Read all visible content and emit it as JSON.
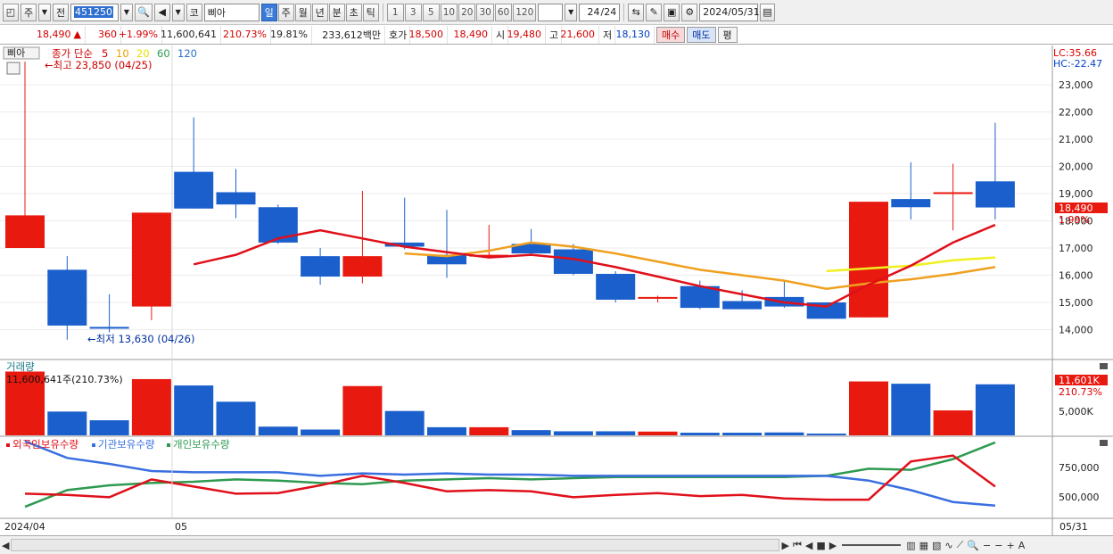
{
  "toolbar": {
    "period_select": "주",
    "prev_label": "전",
    "code": "451250",
    "market_prefix": "코",
    "stock_name": "삐아",
    "interval_tabs": [
      "일",
      "주",
      "월",
      "년",
      "분",
      "초",
      "틱"
    ],
    "active_interval": "일",
    "numbers": [
      "1",
      "3",
      "5",
      "10",
      "20",
      "30",
      "60",
      "120"
    ],
    "page_count": "24",
    "page_total": "/24",
    "date": "2024/05/31"
  },
  "quote": {
    "price": "18,490",
    "arrow": "▲",
    "change": "360",
    "change_pct": "+1.99%",
    "volume": "11,600,641",
    "volume_ratio": "210.73%",
    "turnover": "19.81%",
    "amount": "233,612백만",
    "hoga_label": "호가",
    "ask": "18,500",
    "bid": "18,490",
    "open_label": "시",
    "open": "19,480",
    "high_label": "고",
    "high": "21,600",
    "low_label": "저",
    "low": "18,130",
    "buy_label": "매수",
    "sell_label": "매도",
    "flat_label": "평"
  },
  "price_panel": {
    "stock_tag": "삐아",
    "legend_title": "종가 단순",
    "ma_periods": [
      "5",
      "10",
      "20",
      "60",
      "120"
    ],
    "max_note": "←최고 23,850 (04/25)",
    "min_note": "←최저 13,630 (04/26)",
    "lc_label": "LC:35.66",
    "hc_label": "HC:-22.47",
    "last_price_tag": "18,490",
    "last_pct_tag": "1.99%",
    "y_ticks": [
      "23,000",
      "22,000",
      "21,000",
      "20,000",
      "19,000",
      "18,000",
      "17,000",
      "16,000",
      "15,000",
      "14,000"
    ]
  },
  "volume_panel": {
    "title": "거래량",
    "value_text": "11,600,641주(210.73%)",
    "last_tag": "11,601K",
    "last_pct": "210.73%",
    "y_tick": "5,000K"
  },
  "holding_panel": {
    "legend": [
      "외국인보유수량",
      "기관보유수량",
      "개인보유수량"
    ],
    "y_ticks": [
      "750,000",
      "500,000"
    ]
  },
  "x_axis": {
    "start_label": "2024/04",
    "month_label": "05",
    "end_label": "05/31"
  },
  "colors": {
    "up": "#e8190f",
    "down": "#1a5fcc",
    "ma5": "#e0101a",
    "ma10": "#f0a020",
    "ma20": "#f0f020",
    "foreign": "#e0101a",
    "institution": "#3a6fe0",
    "individual": "#2e9a50"
  },
  "chart_data": {
    "type": "candlestick",
    "candles": [
      {
        "o": 17000,
        "h": 23850,
        "l": 17000,
        "c": 18200
      },
      {
        "o": 16200,
        "h": 16700,
        "l": 13630,
        "c": 14150
      },
      {
        "o": 14100,
        "h": 15300,
        "l": 13900,
        "c": 14050
      },
      {
        "o": 14850,
        "h": 18300,
        "l": 14350,
        "c": 18300
      },
      {
        "o": 19800,
        "h": 21800,
        "l": 18450,
        "c": 18450
      },
      {
        "o": 19050,
        "h": 19900,
        "l": 18100,
        "c": 18600
      },
      {
        "o": 18500,
        "h": 18600,
        "l": 17150,
        "c": 17200
      },
      {
        "o": 16700,
        "h": 17000,
        "l": 15650,
        "c": 15950
      },
      {
        "o": 15950,
        "h": 19100,
        "l": 15700,
        "c": 16700
      },
      {
        "o": 17200,
        "h": 18850,
        "l": 16950,
        "c": 17050
      },
      {
        "o": 16750,
        "h": 18400,
        "l": 15900,
        "c": 16400
      },
      {
        "o": 16700,
        "h": 17850,
        "l": 16650,
        "c": 16750
      },
      {
        "o": 17150,
        "h": 17700,
        "l": 16700,
        "c": 16800
      },
      {
        "o": 16950,
        "h": 17150,
        "l": 16000,
        "c": 16050
      },
      {
        "o": 16050,
        "h": 16150,
        "l": 15000,
        "c": 15100
      },
      {
        "o": 15150,
        "h": 15250,
        "l": 15000,
        "c": 15200
      },
      {
        "o": 15600,
        "h": 15800,
        "l": 14750,
        "c": 14800
      },
      {
        "o": 15050,
        "h": 15450,
        "l": 14750,
        "c": 14750
      },
      {
        "o": 15200,
        "h": 15800,
        "l": 14800,
        "c": 14850
      },
      {
        "o": 15000,
        "h": 15000,
        "l": 14400,
        "c": 14400
      },
      {
        "o": 14450,
        "h": 18700,
        "l": 14450,
        "c": 18700
      },
      {
        "o": 18800,
        "h": 20150,
        "l": 18050,
        "c": 18500
      },
      {
        "o": 19050,
        "h": 20100,
        "l": 17650,
        "c": 19050
      },
      {
        "o": 19450,
        "h": 21600,
        "l": 18050,
        "c": 18490
      }
    ],
    "ma5": [
      null,
      null,
      null,
      null,
      16400,
      16750,
      17350,
      17650,
      17350,
      17050,
      16850,
      16650,
      16750,
      16600,
      16300,
      15950,
      15600,
      15300,
      15000,
      14850,
      15650,
      16350,
      17200,
      17850
    ],
    "ma10": [
      null,
      null,
      null,
      null,
      null,
      null,
      null,
      null,
      null,
      16800,
      16700,
      16900,
      17200,
      17050,
      16800,
      16500,
      16200,
      16000,
      15800,
      15500,
      15700,
      15850,
      16050,
      16300
    ],
    "ma20": [
      null,
      null,
      null,
      null,
      null,
      null,
      null,
      null,
      null,
      null,
      null,
      null,
      null,
      null,
      null,
      null,
      null,
      null,
      null,
      16150,
      16250,
      16350,
      16550,
      16650
    ],
    "volume": [
      11000,
      4100,
      2600,
      9700,
      8600,
      5800,
      1500,
      1000,
      8500,
      4200,
      1400,
      1400,
      900,
      700,
      700,
      650,
      450,
      450,
      500,
      300,
      9300,
      8900,
      4300,
      8800
    ],
    "foreign": [
      530,
      520,
      500,
      650,
      590,
      530,
      535,
      600,
      680,
      620,
      550,
      560,
      550,
      500,
      520,
      535,
      510,
      520,
      490,
      480,
      480,
      800,
      850,
      590
    ],
    "institution": [
      970,
      830,
      780,
      720,
      710,
      710,
      710,
      680,
      700,
      690,
      700,
      690,
      690,
      680,
      680,
      680,
      680,
      680,
      680,
      680,
      640,
      560,
      460,
      430
    ],
    "individual": [
      420,
      560,
      600,
      620,
      630,
      650,
      640,
      620,
      610,
      640,
      650,
      660,
      650,
      660,
      670,
      670,
      670,
      670,
      670,
      680,
      740,
      730,
      820,
      960
    ]
  }
}
